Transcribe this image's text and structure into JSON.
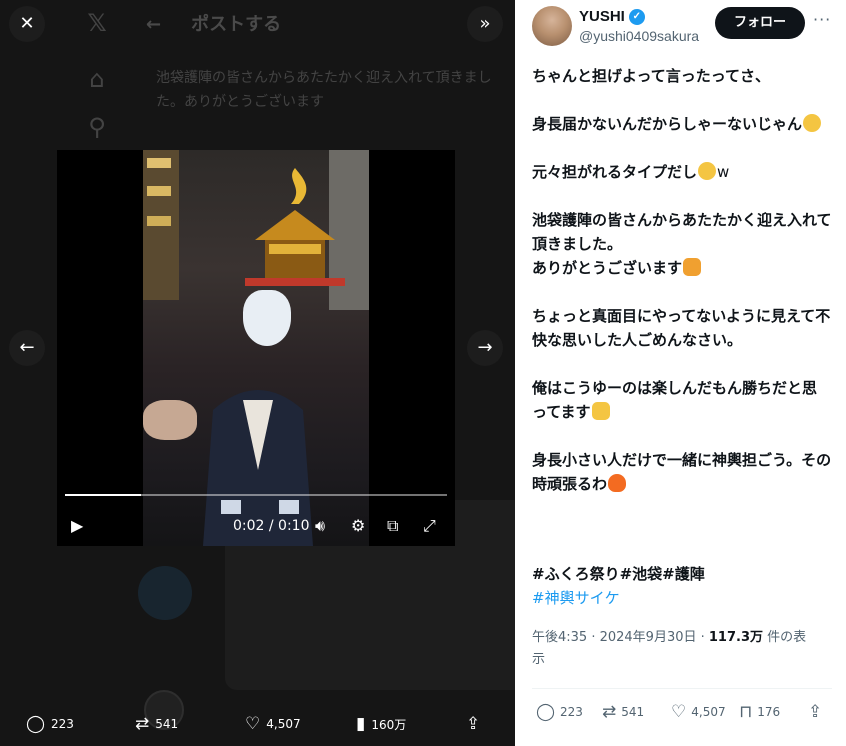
{
  "post": {
    "author_name": "YUSHI",
    "author_handle": "@yushi0409sakura",
    "follow_label": "フォロー",
    "more_label": "···",
    "paragraphs": [
      "ちゃんと担げよって言ったってさ、",
      "身長届かないんだからしゃーないじゃん",
      "元々担がれるタイプだし",
      "池袋護陣の皆さんからあたたかく迎え入れて頂きました。\nありがとうございます",
      "ちょっと真面目にやってないように見えて不快な思いした人ごめんなさい。",
      "俺はこうゆーのは楽しんだもん勝ちだと思ってます",
      "身長小さい人だけで一緒に神輿担ごう。その時頑張るわ"
    ],
    "suffix_w": "w",
    "hashtags_line1": [
      "#ふくろ祭り",
      "#池袋",
      "#護陣"
    ],
    "hashtags_line2": "#神輿サイケ",
    "timestamp": "午後4:35 · 2024年9月30日 · ",
    "views_count": "117.3万",
    "views_label": " 件の表示",
    "replies": "223",
    "reposts": "541",
    "likes": "4,507",
    "bookmarks": "176"
  },
  "media": {
    "header_title": "ポストする",
    "ghost_text": "池袋護陣の皆さんからあたたかく迎え入れて頂きました。ありがとうございます",
    "time_display": "0:02 / 0:10",
    "progress_fraction": 0.2,
    "replies": "223",
    "reposts": "541",
    "likes": "4,507",
    "views": "160万"
  },
  "colors": {
    "accent": "#1d9bf0",
    "panel_bg": "#ffffff",
    "media_bg": "#151515"
  },
  "icons": [
    "close-icon",
    "expand-icon",
    "prev-arrow-icon",
    "next-arrow-icon",
    "play-icon",
    "volume-icon",
    "settings-icon",
    "pip-icon",
    "fullscreen-icon",
    "reply-icon",
    "repost-icon",
    "like-icon",
    "views-icon",
    "share-icon",
    "bookmark-icon",
    "verified-icon"
  ]
}
